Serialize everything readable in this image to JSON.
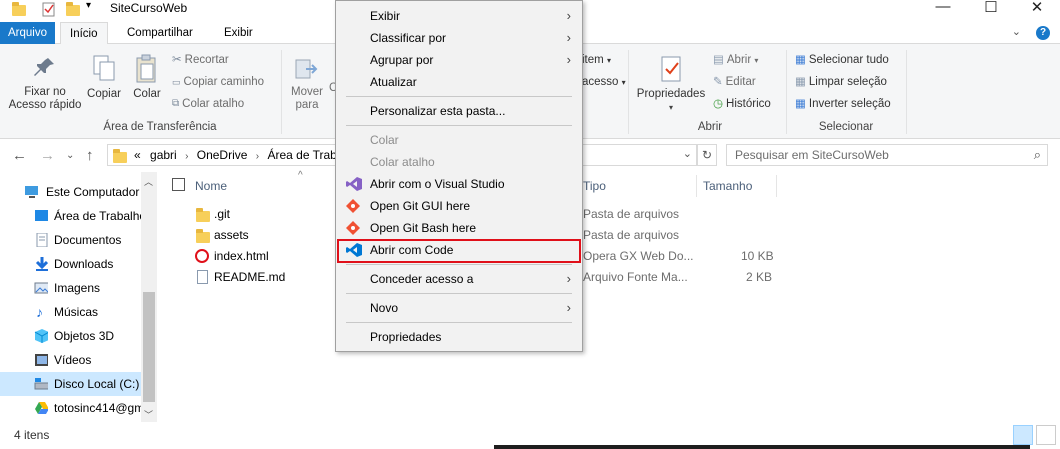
{
  "window": {
    "title": "SiteCursoWeb"
  },
  "ribbon_tabs": {
    "file": "Arquivo",
    "home": "Início",
    "share": "Compartilhar",
    "view": "Exibir"
  },
  "ribbon": {
    "pin_quick_access": "Fixar no Acesso rápido",
    "pin_line1": "Fixar no",
    "pin_line2": "Acesso rápido",
    "copy": "Copiar",
    "paste": "Colar",
    "cut": "Recortar",
    "copy_path": "Copiar caminho",
    "paste_shortcut": "Colar atalho",
    "clipboard_group": "Área de Transferência",
    "move_to": "Mover para",
    "move_line1": "Mover",
    "move_line2": "para",
    "new_item_partial": "item",
    "easy_access_partial": "acesso",
    "properties": "Propriedades",
    "open_dropdown": "Abrir",
    "edit": "Editar",
    "history": "Histórico",
    "open_group": "Abrir",
    "select_all": "Selecionar tudo",
    "select_none": "Limpar seleção",
    "invert_selection": "Inverter seleção",
    "select_group": "Selecionar"
  },
  "address": {
    "overflow": "«",
    "crumbs": [
      "gabri",
      "OneDrive",
      "Área de Trabalho"
    ],
    "search_placeholder": "Pesquisar em SiteCursoWeb"
  },
  "nav_pane": {
    "items": [
      {
        "label": "Este Computador",
        "icon": "computer-icon"
      },
      {
        "label": "Área de Trabalho",
        "icon": "desktop-icon"
      },
      {
        "label": "Documentos",
        "icon": "documents-icon"
      },
      {
        "label": "Downloads",
        "icon": "downloads-icon"
      },
      {
        "label": "Imagens",
        "icon": "pictures-icon"
      },
      {
        "label": "Músicas",
        "icon": "music-icon"
      },
      {
        "label": "Objetos 3D",
        "icon": "objects-3d-icon"
      },
      {
        "label": "Vídeos",
        "icon": "videos-icon"
      },
      {
        "label": "Disco Local (C:)",
        "icon": "drive-icon"
      },
      {
        "label": "totosinc414@gm",
        "icon": "google-drive-icon"
      }
    ]
  },
  "file_list": {
    "columns": {
      "name": "Nome",
      "type": "Tipo",
      "size": "Tamanho"
    },
    "rows": [
      {
        "name": ".git",
        "type": "Pasta de arquivos",
        "size": "",
        "icon": "folder-icon"
      },
      {
        "name": "assets",
        "type": "Pasta de arquivos",
        "size": "",
        "icon": "folder-icon"
      },
      {
        "name": "index.html",
        "type": "Opera GX Web Do...",
        "size": "10 KB",
        "icon": "opera-icon"
      },
      {
        "name": "README.md",
        "type": "Arquivo Fonte Ma...",
        "size": "2 KB",
        "icon": "markdown-file-icon"
      }
    ]
  },
  "status": {
    "count": "4 itens"
  },
  "context_menu": {
    "view": "Exibir",
    "sort_by": "Classificar por",
    "group_by": "Agrupar por",
    "refresh": "Atualizar",
    "customize": "Personalizar esta pasta...",
    "paste": "Colar",
    "paste_shortcut": "Colar atalho",
    "open_vs": "Abrir com o Visual Studio",
    "git_gui": "Open Git GUI here",
    "git_bash": "Open Git Bash here",
    "open_code": "Abrir com Code",
    "give_access": "Conceder acesso a",
    "new": "Novo",
    "properties": "Propriedades"
  },
  "colors": {
    "accent": "#1979ca",
    "highlight_border": "#e0101a",
    "selection": "#cce8ff"
  }
}
